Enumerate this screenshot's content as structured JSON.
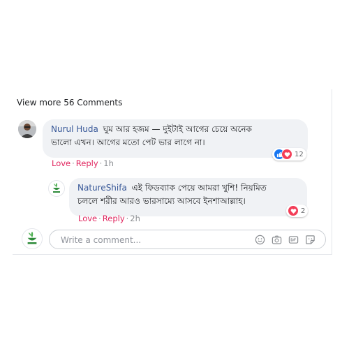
{
  "view_more_label": "View more 56 Comments",
  "comments": [
    {
      "author": "Nurul Huda",
      "line1": "ঘুম আর হজম — দুইটাই আগের চেয়ে অনেক",
      "line2": "ভালো এখন। আগের মতো পেট ভার লাগে না।",
      "actions": {
        "love": "Love",
        "reply": "Reply",
        "time": "1h"
      },
      "reaction_count": "12"
    },
    {
      "author": "NatureShifa",
      "line1": "এই ফিডব্যাক পেয়ে আমরা খুশি! নিয়মিত",
      "line2": "চললে শরীর আরও ভারসাম্যে আসবে ইনশাআল্লাহ।",
      "actions": {
        "love": "Love",
        "reply": "Reply",
        "time": "2h"
      },
      "reaction_count": "2"
    }
  ],
  "composer": {
    "placeholder": "Write a comment..."
  },
  "icons": {
    "like": "like-icon",
    "love": "love-icon",
    "emoji": "emoji-icon",
    "camera": "camera-icon",
    "gif": "gif-icon",
    "sticker": "sticker-icon"
  },
  "colors": {
    "author": "#385898",
    "action": "#e0245e",
    "bubble": "#f0f2f5",
    "like": "#1877f2",
    "love": "#f33e58",
    "brand_green": "#2e8b3a"
  }
}
